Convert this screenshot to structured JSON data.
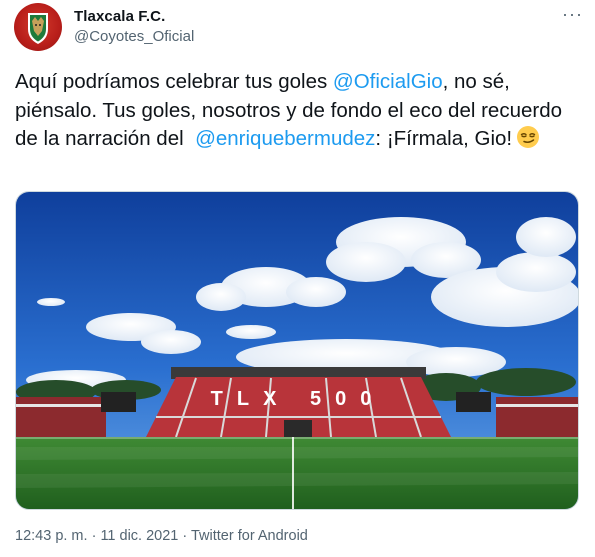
{
  "account": {
    "name": "Tlaxcala F.C.",
    "handle": "@Coyotes_Oficial"
  },
  "menu": {
    "more_label": "···"
  },
  "tweet": {
    "part1": "Aquí podríamos celebrar tus goles ",
    "mention1": "@OficialGio",
    "part2": ", no sé, piénsalo. Tus goles, nosotros y de fondo el eco del recuerdo de la narración del  ",
    "mention2": "@enriquebermudez",
    "part3": ": ¡Fírmala, Gio!",
    "emoji": "smirking-face-emoji"
  },
  "media": {
    "stadium_sign": "TLX 500",
    "colors": {
      "sky": "#1f5fbf",
      "pitch": "#2f7a2a",
      "stands": "#b8343a"
    }
  },
  "meta": {
    "time": "12:43 p. m.",
    "separator1": " · ",
    "date": "11 dic. 2021",
    "separator2": " · ",
    "source": "Twitter for Android"
  },
  "colors": {
    "link": "#1d9bf0",
    "secondary": "#536471",
    "text": "#0f1419"
  }
}
